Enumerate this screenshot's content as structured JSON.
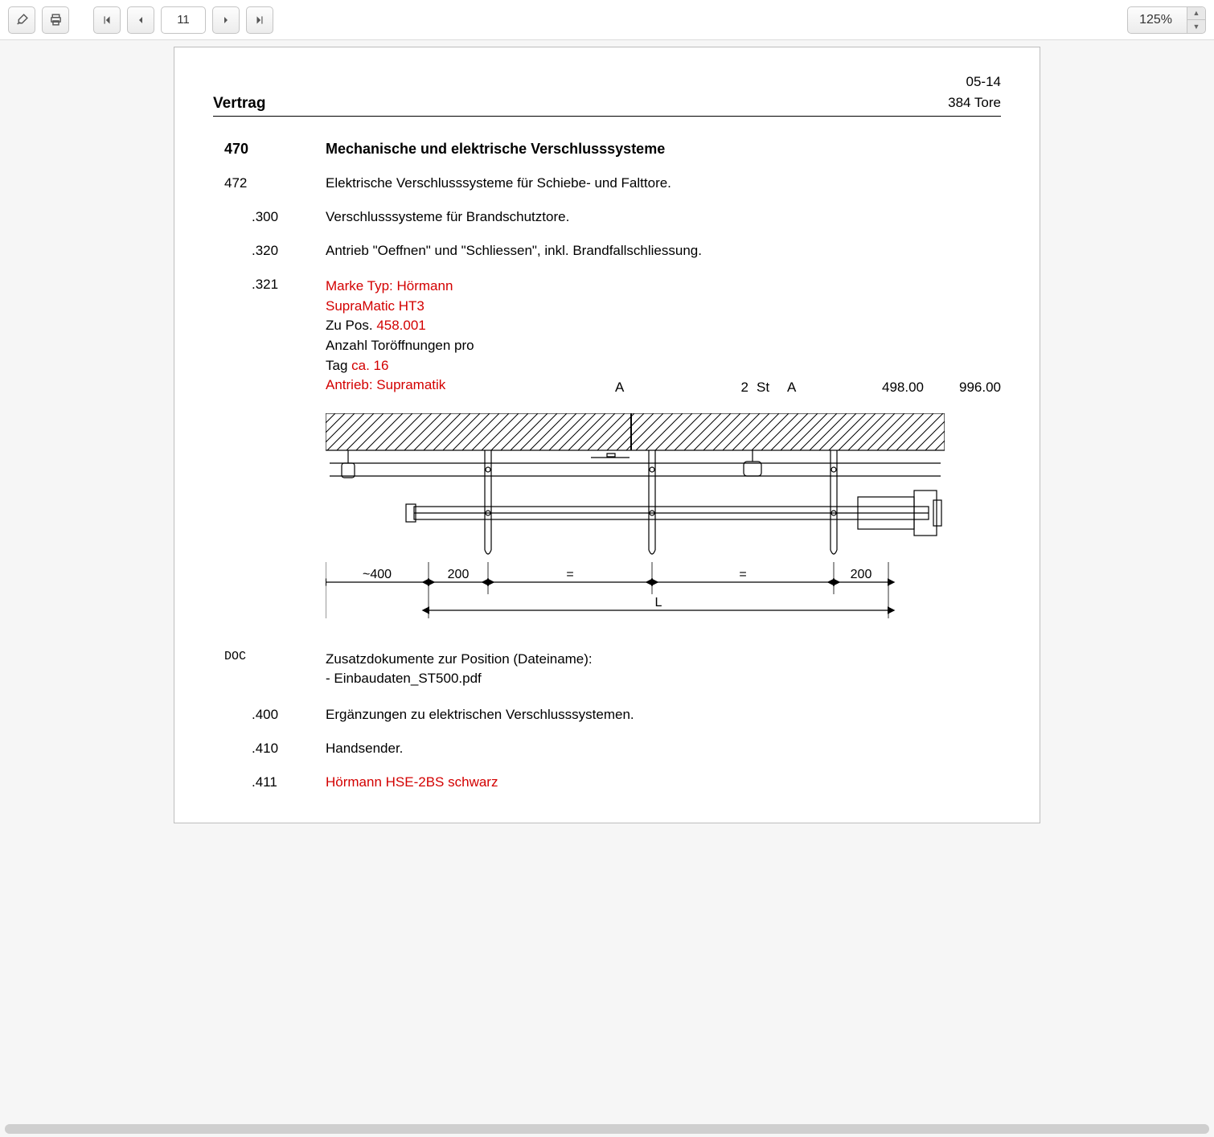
{
  "toolbar": {
    "paint_icon": "brush-icon",
    "print_icon": "print-icon",
    "first_icon": "first-page-icon",
    "prev_icon": "prev-page-icon",
    "next_icon": "next-page-icon",
    "last_icon": "last-page-icon",
    "page_number": "11",
    "zoom": "125%"
  },
  "header": {
    "title": "Vertrag",
    "code": "05-14",
    "section": "384 Tore"
  },
  "rows": {
    "r470": {
      "num": "470",
      "text": "Mechanische und elektrische Verschlusssysteme"
    },
    "r472": {
      "num": "472",
      "text": "Elektrische Verschlusssysteme für Schiebe- und Falttore."
    },
    "r300": {
      "num": ".300",
      "text": "Verschlusssysteme für Brandschutztore."
    },
    "r320": {
      "num": ".320",
      "text": "Antrieb \"Oeffnen\" und \"Schliessen\", inkl. Brandfallschliessung."
    },
    "r321": {
      "num": ".321",
      "l1_label": "Marke Typ: ",
      "l1_val": "Hörmann",
      "l2": "SupraMatic HT3",
      "l3_label": "Zu Pos. ",
      "l3_val": "458.001",
      "l4": "Anzahl Toröffnungen pro",
      "l5_label": "Tag ",
      "l5_val": "ca. 16",
      "l6": "Antrieb: Supramatik",
      "colA1": "A",
      "qty": "2",
      "unit": "St",
      "colA2": "A",
      "price": "498.00",
      "total": "996.00"
    },
    "doc": {
      "num": "DOC",
      "l1": "Zusatzdokumente zur Position (Dateiname):",
      "l2": "- Einbaudaten_ST500.pdf"
    },
    "r400": {
      "num": ".400",
      "text": "Ergänzungen zu elektrischen Verschlusssystemen."
    },
    "r410": {
      "num": ".410",
      "text": "Handsender."
    },
    "r411": {
      "num": ".411",
      "text": "Hörmann HSE-2BS schwarz"
    }
  },
  "drawing": {
    "dim1": "~400",
    "dim2": "200",
    "dim3": "=",
    "dim4": "=",
    "dim5": "200",
    "dimL": "L"
  }
}
